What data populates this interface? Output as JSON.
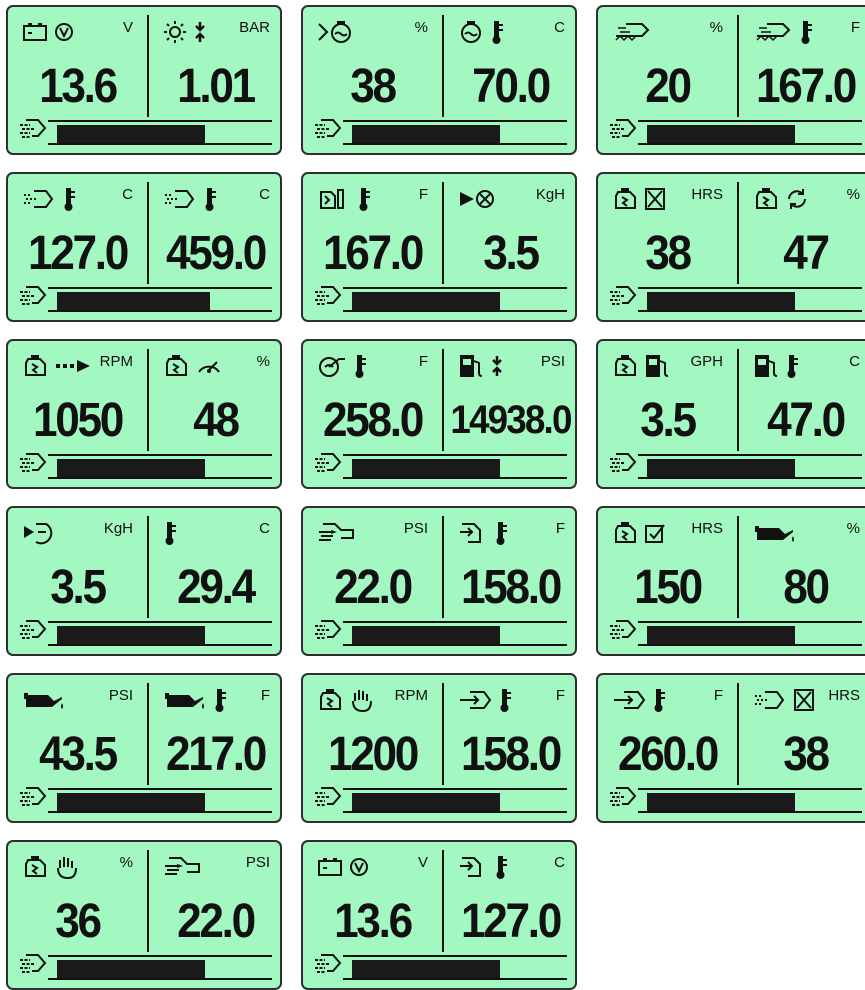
{
  "panels": [
    {
      "left": {
        "icons": [
          "battery-icon",
          "voltage-circle-icon"
        ],
        "unit": "V",
        "value": "13.6"
      },
      "right": {
        "icons": [
          "sun-icon",
          "pressure-arrows-icon"
        ],
        "unit": "BAR",
        "value": "1.01"
      },
      "load": 0.68
    },
    {
      "left": {
        "icons": [
          "engine-load-icon"
        ],
        "unit": "%",
        "value": "38"
      },
      "right": {
        "icons": [
          "coolant-icon",
          "thermometer-icon"
        ],
        "unit": "C",
        "value": "70.0"
      },
      "load": 0.68
    },
    {
      "left": {
        "icons": [
          "intake-manifold-icon"
        ],
        "unit": "%",
        "value": "20"
      },
      "right": {
        "icons": [
          "intake-manifold-icon",
          "thermometer-icon"
        ],
        "unit": "F",
        "value": "167.0"
      },
      "load": 0.68
    },
    {
      "left": {
        "icons": [
          "exhaust-icon",
          "thermometer-icon"
        ],
        "unit": "C",
        "value": "127.0"
      },
      "right": {
        "icons": [
          "exhaust-icon",
          "thermometer-icon"
        ],
        "unit": "C",
        "value": "459.0"
      },
      "load": 0.7
    },
    {
      "left": {
        "icons": [
          "engine-block-icon",
          "thermometer-icon"
        ],
        "unit": "F",
        "value": "167.0"
      },
      "right": {
        "icons": [
          "fuel-flow-icon"
        ],
        "unit": "KgH",
        "value": "3.5"
      },
      "load": 0.68
    },
    {
      "left": {
        "icons": [
          "engine-icon",
          "hours-icon"
        ],
        "unit": "HRS",
        "value": "38"
      },
      "right": {
        "icons": [
          "engine-icon",
          "cycle-icon"
        ],
        "unit": "%",
        "value": "47"
      },
      "load": 0.68
    },
    {
      "left": {
        "icons": [
          "engine-icon",
          "arrow-right-icon"
        ],
        "unit": "RPM",
        "value": "1050"
      },
      "right": {
        "icons": [
          "engine-icon",
          "gauge-icon"
        ],
        "unit": "%",
        "value": "48"
      },
      "load": 0.68
    },
    {
      "left": {
        "icons": [
          "turbo-icon",
          "thermometer-icon"
        ],
        "unit": "F",
        "value": "258.0"
      },
      "right": {
        "icons": [
          "fuel-pump-icon",
          "pressure-arrows-icon"
        ],
        "unit": "PSI",
        "value": "14938.0"
      },
      "load": 0.68
    },
    {
      "left": {
        "icons": [
          "engine-icon",
          "fuel-pump-icon"
        ],
        "unit": "GPH",
        "value": "3.5"
      },
      "right": {
        "icons": [
          "fuel-pump-icon",
          "thermometer-icon"
        ],
        "unit": "C",
        "value": "47.0"
      },
      "load": 0.68
    },
    {
      "left": {
        "icons": [
          "fuel-in-icon"
        ],
        "unit": "KgH",
        "value": "3.5"
      },
      "right": {
        "icons": [
          "thermometer-icon"
        ],
        "unit": "C",
        "value": "29.4"
      },
      "load": 0.68
    },
    {
      "left": {
        "icons": [
          "intake-pressure-icon"
        ],
        "unit": "PSI",
        "value": "22.0"
      },
      "right": {
        "icons": [
          "intake-return-icon",
          "thermometer-icon"
        ],
        "unit": "F",
        "value": "158.0"
      },
      "load": 0.68
    },
    {
      "left": {
        "icons": [
          "engine-icon",
          "check-icon"
        ],
        "unit": "HRS",
        "value": "150"
      },
      "right": {
        "icons": [
          "oil-can-icon"
        ],
        "unit": "%",
        "value": "80"
      },
      "load": 0.68
    },
    {
      "left": {
        "icons": [
          "oil-can-icon"
        ],
        "unit": "PSI",
        "value": "43.5"
      },
      "right": {
        "icons": [
          "oil-can-icon",
          "thermometer-icon"
        ],
        "unit": "F",
        "value": "217.0"
      },
      "load": 0.68
    },
    {
      "left": {
        "icons": [
          "engine-icon",
          "hand-icon"
        ],
        "unit": "RPM",
        "value": "1200"
      },
      "right": {
        "icons": [
          "inlet-icon",
          "thermometer-icon"
        ],
        "unit": "F",
        "value": "158.0"
      },
      "load": 0.68
    },
    {
      "left": {
        "icons": [
          "inlet-icon",
          "thermometer-icon"
        ],
        "unit": "F",
        "value": "260.0"
      },
      "right": {
        "icons": [
          "exhaust-icon",
          "hours-icon"
        ],
        "unit": "HRS",
        "value": "38"
      },
      "load": 0.68
    },
    {
      "left": {
        "icons": [
          "engine-icon",
          "hand-icon"
        ],
        "unit": "%",
        "value": "36"
      },
      "right": {
        "icons": [
          "intake-pressure-icon"
        ],
        "unit": "PSI",
        "value": "22.0"
      },
      "load": 0.68
    },
    {
      "left": {
        "icons": [
          "battery-icon",
          "voltage-circle-icon"
        ],
        "unit": "V",
        "value": "13.6"
      },
      "right": {
        "icons": [
          "intake-return-icon",
          "thermometer-icon"
        ],
        "unit": "C",
        "value": "127.0"
      },
      "load": 0.68
    }
  ],
  "footer_icon": "turbo-wind-icon",
  "colors": {
    "panel_bg": "#a3f7c1",
    "ink": "#111111",
    "border": "#2f2f2f"
  }
}
